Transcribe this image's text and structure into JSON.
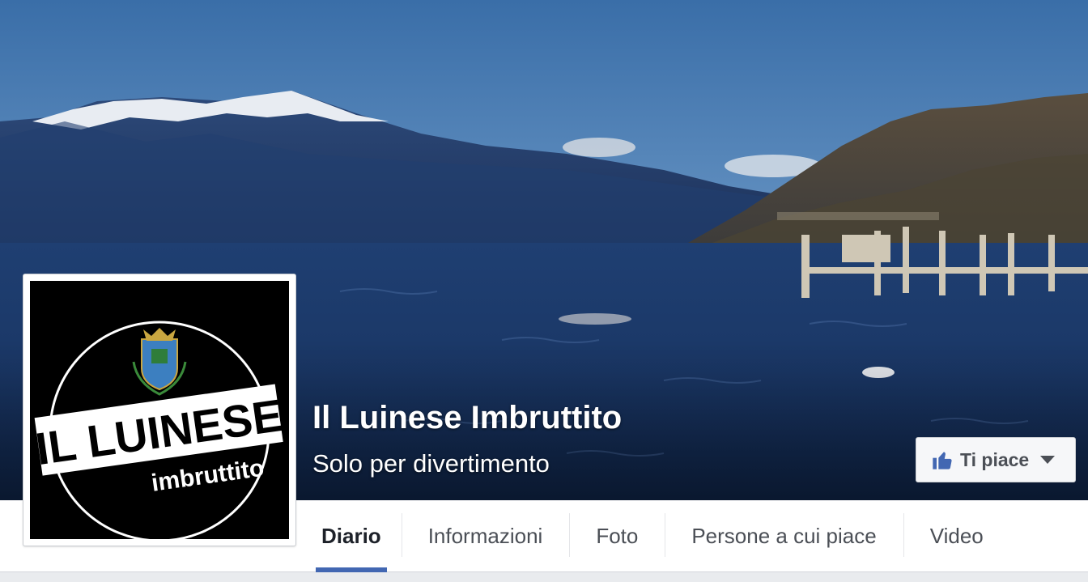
{
  "page": {
    "name": "Il Luinese Imbruttito",
    "category": "Solo per divertimento"
  },
  "profile": {
    "logo_line1": "IL LUINESE",
    "logo_line2": "imbruttito"
  },
  "like_button": {
    "label": "Ti piace",
    "icon": "thumbs-up-icon"
  },
  "tabs": [
    {
      "label": "Diario",
      "active": true
    },
    {
      "label": "Informazioni",
      "active": false
    },
    {
      "label": "Foto",
      "active": false
    },
    {
      "label": "Persone a cui piace",
      "active": false
    },
    {
      "label": "Video",
      "active": false
    }
  ],
  "colors": {
    "accent": "#4267b2",
    "tab_text": "#4b4f56",
    "like_icon": "#4267b2"
  }
}
